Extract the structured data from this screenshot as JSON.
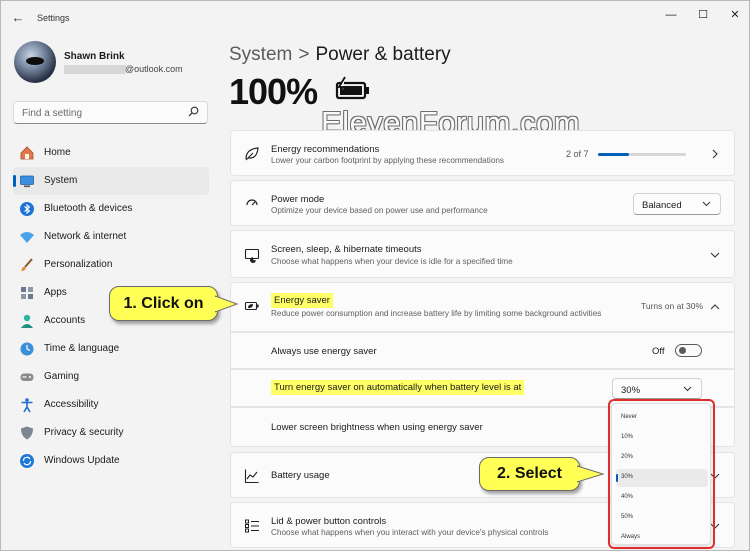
{
  "window": {
    "app_title": "Settings",
    "back_glyph": "←",
    "minimize_glyph": "—",
    "maximize_glyph": "☐",
    "close_glyph": "✕"
  },
  "user": {
    "name": "Shawn Brink",
    "email": "@outlook.com"
  },
  "search": {
    "placeholder": "Find a setting",
    "icon": "search-icon"
  },
  "sidebar": {
    "items": [
      {
        "label": "Home",
        "icon": "home-icon",
        "color": "#d45b3c"
      },
      {
        "label": "System",
        "icon": "system-icon",
        "color": "#2a7fd4",
        "active": true
      },
      {
        "label": "Bluetooth & devices",
        "icon": "bluetooth-icon",
        "color": "#1e73d6"
      },
      {
        "label": "Network & internet",
        "icon": "wifi-icon",
        "color": "#4aa3e8"
      },
      {
        "label": "Personalization",
        "icon": "brush-icon",
        "color": "#e28a3a"
      },
      {
        "label": "Apps",
        "icon": "apps-icon",
        "color": "#6b7a8c"
      },
      {
        "label": "Accounts",
        "icon": "accounts-icon",
        "color": "#2bb3a0"
      },
      {
        "label": "Time & language",
        "icon": "globe-clock-icon",
        "color": "#3a8fd6"
      },
      {
        "label": "Gaming",
        "icon": "gamepad-icon",
        "color": "#8a8a8a"
      },
      {
        "label": "Accessibility",
        "icon": "accessibility-icon",
        "color": "#1e6fd0"
      },
      {
        "label": "Privacy & security",
        "icon": "shield-icon",
        "color": "#7d8590"
      },
      {
        "label": "Windows Update",
        "icon": "update-icon",
        "color": "#1e79d6"
      }
    ]
  },
  "header": {
    "breadcrumb_parent": "System",
    "breadcrumb_sep": ">",
    "breadcrumb_current": "Power & battery",
    "battery_percent": "100%",
    "watermark": "ElevenForum.com"
  },
  "cards": {
    "energy_recommendations": {
      "title": "Energy recommendations",
      "desc": "Lower your carbon footprint by applying these recommendations",
      "progress_text": "2 of 7",
      "progress_fraction": 0.35
    },
    "power_mode": {
      "title": "Power mode",
      "desc": "Optimize your device based on power use and performance",
      "value": "Balanced"
    },
    "screen_sleep": {
      "title": "Screen, sleep, & hibernate timeouts",
      "desc": "Choose what happens when your device is idle for a specified time"
    },
    "energy_saver": {
      "title": "Energy saver",
      "desc": "Reduce power consumption and increase battery life by limiting some background activities",
      "status": "Turns on at 30%",
      "always_use_label": "Always use energy saver",
      "always_use_state": "Off",
      "auto_label": "Turn energy saver on automatically when battery level is at",
      "auto_value": "30%",
      "lower_brightness_label": "Lower screen brightness when using energy saver"
    },
    "battery_usage": {
      "title": "Battery usage"
    },
    "lid_power": {
      "title": "Lid & power button controls",
      "desc": "Choose what happens when you interact with your device's physical controls"
    }
  },
  "popup": {
    "options": [
      "Never",
      "10%",
      "20%",
      "30%",
      "40%",
      "50%",
      "Always"
    ],
    "selected_index": 3
  },
  "annotations": {
    "callout_1": "1. Click on",
    "callout_2": "2. Select",
    "callout_color": "#ffff55",
    "box_color": "#e12c2c"
  }
}
